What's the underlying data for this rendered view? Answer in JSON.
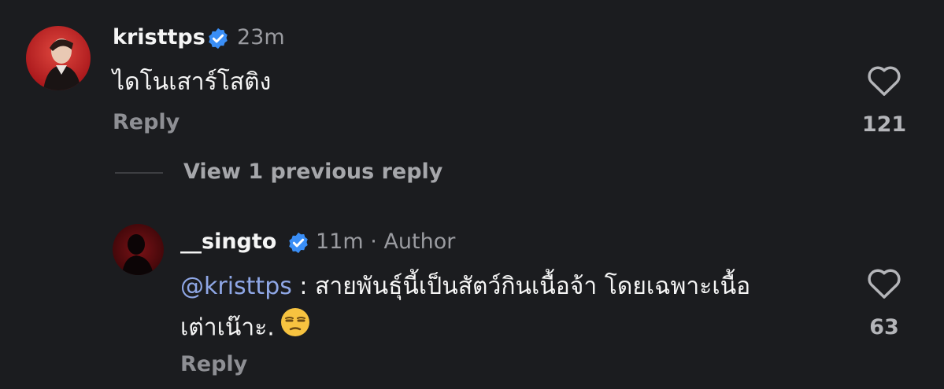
{
  "comment": {
    "username": "kristtps",
    "time": "23m",
    "text": "ไดโนเสาร์โสติง",
    "reply_label": "Reply",
    "like_count": "121",
    "avatar_icon": "avatar-photo-icon",
    "verified_icon": "verified-badge-icon"
  },
  "view_replies": {
    "label": "View 1 previous reply"
  },
  "reply": {
    "username": "__singto",
    "time": "11m",
    "separator": "·",
    "author_label": "Author",
    "mention": "@kristtps",
    "text_line1": " : สายพันธุ์นี้เป็นสัตว์กินเนื้อจ้า โดยเฉพาะเนื้อ",
    "text_line2": "เต่าเน๊าะ.",
    "emoji": "unamused-face-emoji",
    "reply_label": "Reply",
    "like_count": "63"
  },
  "colors": {
    "background": "#1b1c1f",
    "verified": "#3a8ef6",
    "mention": "#8fa7e6",
    "muted": "#9a9ba0"
  }
}
